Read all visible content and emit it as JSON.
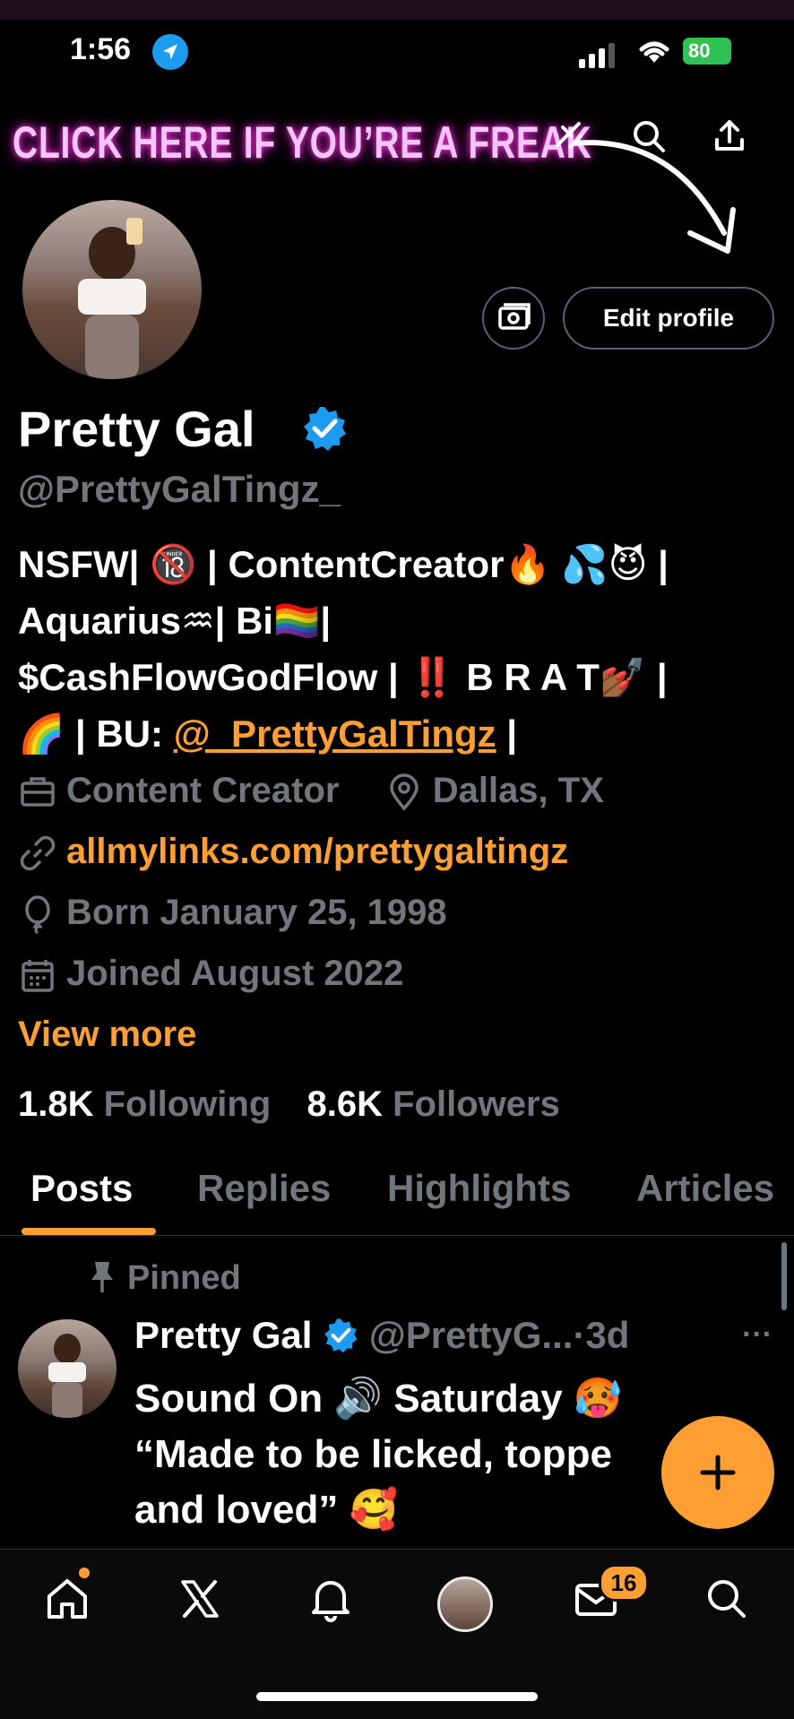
{
  "status_bar": {
    "time": "1:56",
    "battery": "80"
  },
  "header": {
    "banner_text": "CLICK HERE IF YOU’RE A FREAK"
  },
  "profile": {
    "edit_button": "Edit profile",
    "name": "Pretty Gal",
    "handle": "@PrettyGalTingz_",
    "bio_lines": [
      "NSFW| 🔞 | ContentCreator🔥 💦😈 |",
      "Aquarius♒| Bi🏳️‍🌈|",
      "$CashFlowGodFlow | ‼️ B R A T💅🏾 |",
      "🌈 | BU: "
    ],
    "bio_link": "@_PrettyGalTingz",
    "bio_tail": " |",
    "category": "Content Creator",
    "location": "Dallas, TX",
    "website": "allmylinks.com/prettygaltingz",
    "birthday": "Born January 25, 1998",
    "joined": "Joined August 2022",
    "view_more": "View more",
    "following_count": "1.8K",
    "following_label": "Following",
    "followers_count": "8.6K",
    "followers_label": "Followers"
  },
  "tabs": [
    "Posts",
    "Replies",
    "Highlights",
    "Articles"
  ],
  "pinned_post": {
    "pinned_label": "Pinned",
    "author_name": "Pretty Gal",
    "author_handle": "@PrettyG...",
    "separator": "·",
    "time": "3d",
    "line1": "Sound On 🔊 Saturday 🥵",
    "line2": "“Made to be licked, toppe",
    "line3": "and loved” 🥰"
  },
  "bottom_nav": {
    "messages_badge": "16"
  },
  "colors": {
    "accent": "#ff9e32",
    "verified": "#1d9bf0",
    "muted": "#71767b"
  }
}
